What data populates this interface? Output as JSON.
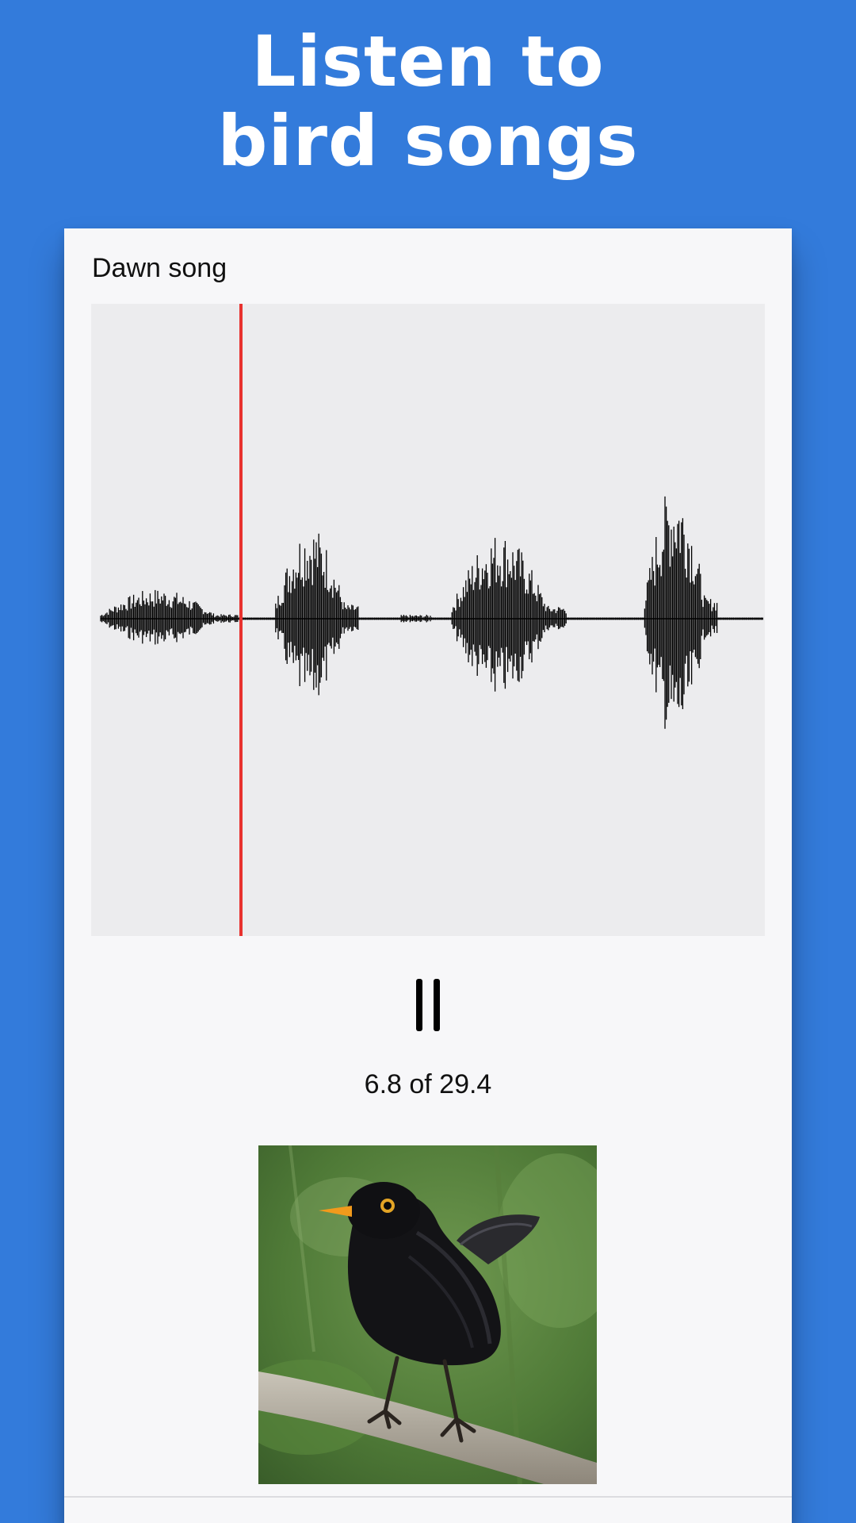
{
  "headline": {
    "line1": "Listen to",
    "line2": "bird songs"
  },
  "player": {
    "track_title": "Dawn song",
    "current_time": 6.8,
    "duration": 29.4,
    "time_text": "6.8 of 29.4",
    "state": "playing",
    "control_icon": "pause-icon",
    "playhead_color": "#e8322f",
    "waveform_color": "#000000",
    "waveform_background": "#ececee"
  },
  "colors": {
    "page_background": "#337bdb",
    "card_background": "#f7f7f9",
    "headline_text": "#ffffff"
  },
  "photo": {
    "subject": "blackbird"
  }
}
